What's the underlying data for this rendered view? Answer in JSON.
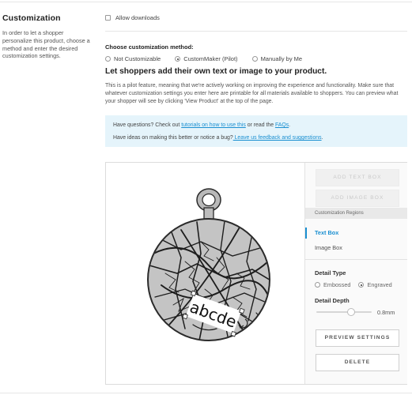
{
  "section": {
    "title": "Customization",
    "description": "In order to let a shopper personalize this product, choose a method and enter the desired customization settings."
  },
  "allow_downloads": {
    "label": "Allow downloads",
    "checked": false
  },
  "method": {
    "label": "Choose customization method:",
    "options": [
      {
        "label": "Not Customizable",
        "selected": false
      },
      {
        "label": "CustomMaker (Pilot)",
        "selected": true
      },
      {
        "label": "Manually by Me",
        "selected": false
      }
    ]
  },
  "headline": "Let shoppers add their own text or image to your product.",
  "pilot_note": "This is a pilot feature, meaning that we're actively working on improving the experience and functionality. Make sure that whatever customization settings you enter here are printable for all materials available to shoppers. You can preview what your shopper will see by clicking 'View Product' at the top of the page.",
  "info": {
    "line1_prefix": "Have questions? Check out ",
    "line1_link1": "tutorials on how to use this",
    "line1_mid": " or read the ",
    "line1_link2": "FAQs",
    "line1_suffix": ".",
    "line2_prefix": "Have ideas on making this better or notice a bug?",
    "line2_link": " Leave us feedback and suggestions",
    "line2_suffix": "."
  },
  "editor": {
    "preview_text": "abcde",
    "add_text_box": "ADD TEXT BOX",
    "add_image_box": "ADD IMAGE BOX",
    "regions_label": "Customization Regions",
    "regions": [
      {
        "label": "Text Box",
        "active": true
      },
      {
        "label": "Image Box",
        "active": false
      }
    ],
    "detail_type_label": "Detail Type",
    "detail_options": [
      {
        "label": "Embossed",
        "selected": false
      },
      {
        "label": "Engraved",
        "selected": true
      }
    ],
    "detail_depth_label": "Detail Depth",
    "detail_depth_value": "0.8mm",
    "detail_depth_level": 0.56,
    "preview_button": "PREVIEW SETTINGS",
    "delete_button": "DELETE"
  },
  "colors": {
    "accent": "#1a8fd1",
    "info_bg": "#e5f4fb",
    "pendant_fill": "#c4c4c4"
  }
}
